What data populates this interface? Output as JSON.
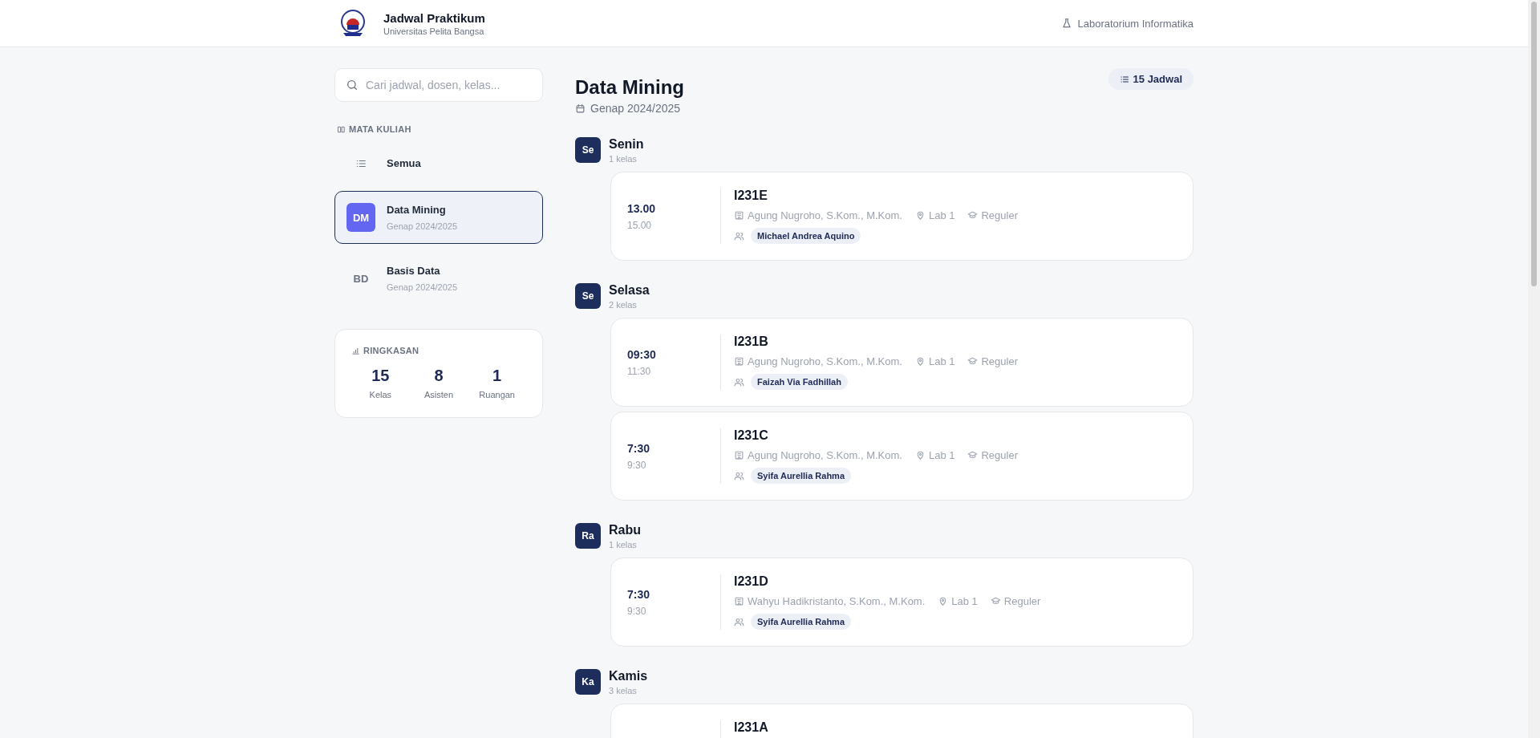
{
  "header": {
    "title": "Jadwal Praktikum",
    "subtitle": "Universitas Pelita Bangsa",
    "lab": "Laboratorium Informatika"
  },
  "search": {
    "placeholder": "Cari jadwal, dosen, kelas..."
  },
  "courses": {
    "heading": "MATA KULIAH",
    "items": [
      {
        "kind": "all",
        "name": "Semua",
        "selected": false
      },
      {
        "kind": "course",
        "badge": "DM",
        "name": "Data Mining",
        "term": "Genap 2024/2025",
        "selected": true
      },
      {
        "kind": "course",
        "badge": "BD",
        "name": "Basis Data",
        "term": "Genap 2024/2025",
        "selected": false
      }
    ]
  },
  "summary": {
    "heading": "RINGKASAN",
    "stats": [
      {
        "value": "15",
        "label": "Kelas"
      },
      {
        "value": "8",
        "label": "Asisten"
      },
      {
        "value": "1",
        "label": "Ruangan"
      }
    ]
  },
  "main": {
    "title": "Data Mining",
    "term": "Genap 2024/2025",
    "count": "15 Jadwal"
  },
  "days": [
    {
      "badge": "Se",
      "name": "Senin",
      "count": "1 kelas",
      "classes": [
        {
          "start": "13.00",
          "end": "15.00",
          "code": "I231E",
          "lecturer": "Agung Nugroho, S.Kom., M.Kom.",
          "room": "Lab 1",
          "type": "Reguler",
          "assistants": [
            "Michael Andrea Aquino"
          ]
        }
      ]
    },
    {
      "badge": "Se",
      "name": "Selasa",
      "count": "2 kelas",
      "classes": [
        {
          "start": "09:30",
          "end": "11:30",
          "code": "I231B",
          "lecturer": "Agung Nugroho, S.Kom., M.Kom.",
          "room": "Lab 1",
          "type": "Reguler",
          "assistants": [
            "Faizah Via Fadhillah"
          ]
        },
        {
          "start": "7:30",
          "end": "9:30",
          "code": "I231C",
          "lecturer": "Agung Nugroho, S.Kom., M.Kom.",
          "room": "Lab 1",
          "type": "Reguler",
          "assistants": [
            "Syifa Aurellia Rahma"
          ]
        }
      ]
    },
    {
      "badge": "Ra",
      "name": "Rabu",
      "count": "1 kelas",
      "classes": [
        {
          "start": "7:30",
          "end": "9:30",
          "code": "I231D",
          "lecturer": "Wahyu Hadikristanto, S.Kom., M.Kom.",
          "room": "Lab 1",
          "type": "Reguler",
          "assistants": [
            "Syifa Aurellia Rahma"
          ]
        }
      ]
    },
    {
      "badge": "Ka",
      "name": "Kamis",
      "count": "3 kelas",
      "classes": [
        {
          "code": "I231A"
        }
      ]
    }
  ]
}
